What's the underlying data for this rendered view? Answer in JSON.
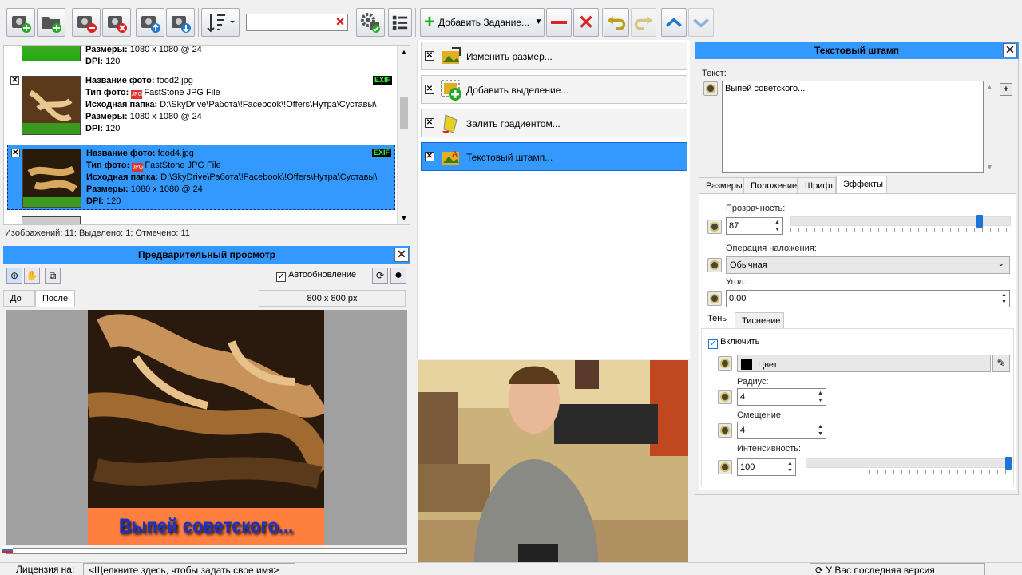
{
  "toolbar": {
    "search_value": "",
    "add_task_label": "Добавить Задание..."
  },
  "image_list": {
    "partial_top": {
      "size_label": "Размеры:",
      "size_value": "1080 x 1080 @ 24",
      "dpi_label": "DPI:",
      "dpi_value": "120"
    },
    "items": [
      {
        "name_label": "Название фото:",
        "name": "food2.jpg",
        "type_label": "Тип фото:",
        "type": "FastStone JPG File",
        "folder_label": "Исходная папка:",
        "folder": "D:\\SkyDrive\\Работа\\!Facebook\\!Offers\\Нутра\\Суставы\\",
        "size_label": "Размеры:",
        "size": "1080 x 1080 @ 24",
        "dpi_label": "DPI:",
        "dpi": "120",
        "exif": "EXIF",
        "checked": "✕"
      },
      {
        "name_label": "Название фото:",
        "name": "food4.jpg",
        "type_label": "Тип фото:",
        "type": "FastStone JPG File",
        "folder_label": "Исходная папка:",
        "folder": "D:\\SkyDrive\\Работа\\!Facebook\\!Offers\\Нутра\\Суставы\\",
        "size_label": "Размеры:",
        "size": "1080 x 1080 @ 24",
        "dpi_label": "DPI:",
        "dpi": "120",
        "exif": "EXIF",
        "checked": "✕"
      }
    ],
    "status": "Изображений: 11; Выделено: 1; Отмечено: 11"
  },
  "preview": {
    "title": "Предварительный просмотр",
    "auto_update_label": "Автообновление",
    "tab_before": "До",
    "tab_after": "После",
    "size_readout": "800 x 800 px",
    "stamp_text": "Выпей советского..."
  },
  "tasks": [
    {
      "label": "Изменить размер...",
      "checked": "✕",
      "icon": "resize-icon"
    },
    {
      "label": "Добавить выделение...",
      "checked": "✕",
      "icon": "add-selection-icon"
    },
    {
      "label": "Залить градиентом...",
      "checked": "✕",
      "icon": "gradient-fill-icon"
    },
    {
      "label": "Текстовый штамп...",
      "checked": "✕",
      "icon": "text-stamp-icon"
    }
  ],
  "stamp_panel": {
    "title": "Текстовый штамп",
    "text_label": "Текст:",
    "text_value": "Выпей советского...",
    "tabs": [
      "Размеры",
      "Положение",
      "Шрифт",
      "Эффекты"
    ],
    "opacity_label": "Прозрачность:",
    "opacity_value": "87",
    "opacity_level": 0.87,
    "blend_label": "Операция наложения:",
    "blend_value": "Обычная",
    "angle_label": "Угол:",
    "angle_value": "0,00",
    "subtabs": [
      "Тень",
      "Тиснение"
    ],
    "enable_label": "Включить",
    "color_label": "Цвет",
    "radius_label": "Радиус:",
    "radius_value": "4",
    "offset_label": "Смещение:",
    "offset_value": "4",
    "intensity_label": "Интенсивность:",
    "intensity_value": "100",
    "intensity_level": 1.0
  },
  "footer": {
    "license_label": "Лицензия на:",
    "license_prompt": "<Щелкните здесь, чтобы задать свое имя>",
    "version_status": "У Вас последняя версия"
  },
  "colors": {
    "accent": "#3399ff",
    "stamp_bg": "#ff7f3f",
    "stamp_text": "#1a30c8"
  }
}
